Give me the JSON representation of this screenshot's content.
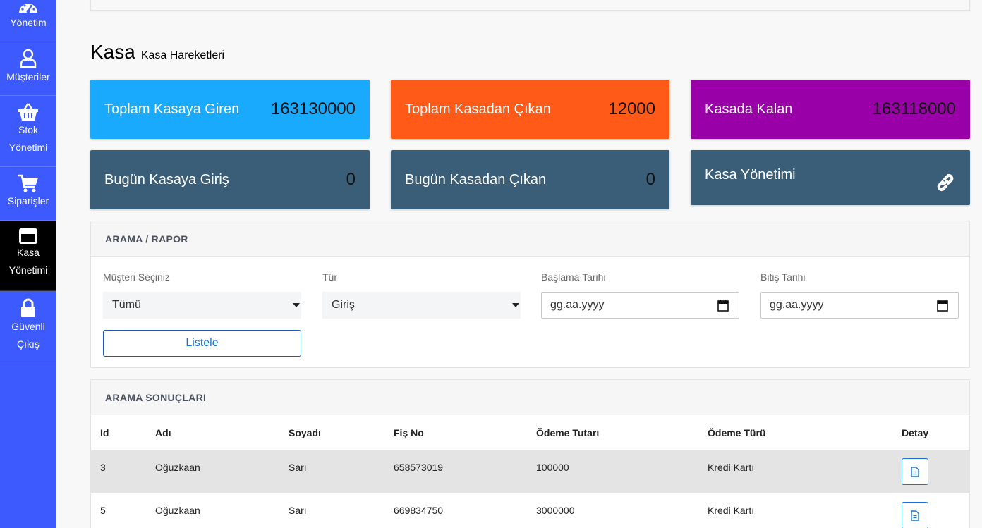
{
  "sidebar": {
    "items": [
      {
        "line1": "Yönetim",
        "line2": "",
        "icon": "gauge-icon"
      },
      {
        "line1": "Müşteriler",
        "line2": "",
        "icon": "user-icon"
      },
      {
        "line1": "Stok",
        "line2": "Yönetimi",
        "icon": "basket-icon"
      },
      {
        "line1": "Siparişler",
        "line2": "",
        "icon": "cart-icon"
      },
      {
        "line1": "Kasa",
        "line2": "Yönetimi",
        "icon": "wallet-icon",
        "active": true
      },
      {
        "line1": "Güvenli",
        "line2": "Çıkış",
        "icon": "lock-icon"
      }
    ]
  },
  "page": {
    "title": "Kasa",
    "subtitle": "Kasa Hareketleri"
  },
  "tiles": {
    "total_in": {
      "label": "Toplam Kasaya Giren",
      "value": "163130000"
    },
    "total_out": {
      "label": "Toplam Kasadan Çıkan",
      "value": "12000"
    },
    "remaining": {
      "label": "Kasada Kalan",
      "value": "163118000"
    },
    "today_in": {
      "label": "Bugün Kasaya Giriş",
      "value": "0"
    },
    "today_out": {
      "label": "Bugün Kasadan Çıkan",
      "value": "0"
    },
    "manage": {
      "label": "Kasa Yönetimi",
      "icon": "link-icon"
    }
  },
  "colors": {
    "sidebar": "#3d5afe",
    "tile_blue": "#19a9fd",
    "tile_orange": "#ff5a17",
    "tile_purple": "#9900a8",
    "tile_slate": "#3b5e78",
    "accent": "#1a73d9"
  },
  "search": {
    "title": "ARAMA / RAPOR",
    "customer_label": "Müşteri Seçiniz",
    "customer_value": "Tümü",
    "type_label": "Tür",
    "type_value": "Giriş",
    "start_label": "Başlama Tarihi",
    "start_placeholder": "gg.aa.yyyy",
    "end_label": "Bitiş Tarihi",
    "end_placeholder": "gg.aa.yyyy",
    "list_button": "Listele"
  },
  "results": {
    "title": "ARAMA SONUÇLARI",
    "columns": [
      "Id",
      "Adı",
      "Soyadı",
      "Fiş No",
      "Ödeme Tutarı",
      "Ödeme Türü",
      "Detay"
    ],
    "rows": [
      {
        "id": "3",
        "name": "Oğuzkaan",
        "surname": "Sarı",
        "receipt": "658573019",
        "amount": "100000",
        "method": "Kredi Kartı"
      },
      {
        "id": "5",
        "name": "Oğuzkaan",
        "surname": "Sarı",
        "receipt": "669834750",
        "amount": "3000000",
        "method": "Kredi Kartı"
      }
    ]
  }
}
